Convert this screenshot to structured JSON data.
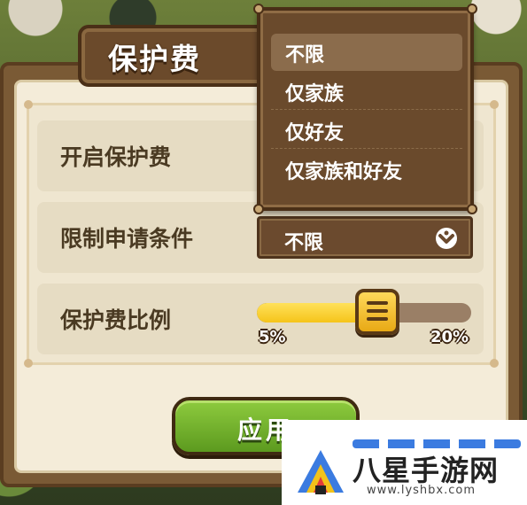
{
  "dialog": {
    "title": "保护费"
  },
  "rows": [
    {
      "label": "开启保护费"
    },
    {
      "label": "限制申请条件"
    },
    {
      "label": "保护费比例"
    }
  ],
  "condition_select": {
    "selected": "不限"
  },
  "dropdown": {
    "options": [
      "不限",
      "仅家族",
      "仅好友",
      "仅家族和好友"
    ],
    "selected_index": 0
  },
  "ratio_slider": {
    "min_label": "5%",
    "max_label": "20%",
    "value_fraction": 0.55
  },
  "apply_button": {
    "label": "应用"
  },
  "watermark": {
    "title": "八星手游网",
    "url": "www.lyshbx.com"
  },
  "colors": {
    "panel_wood": "#7a5a35",
    "panel_paper": "#f4ecd9",
    "button_green": "#6fb02a",
    "slider_fill": "#f5c41a"
  }
}
